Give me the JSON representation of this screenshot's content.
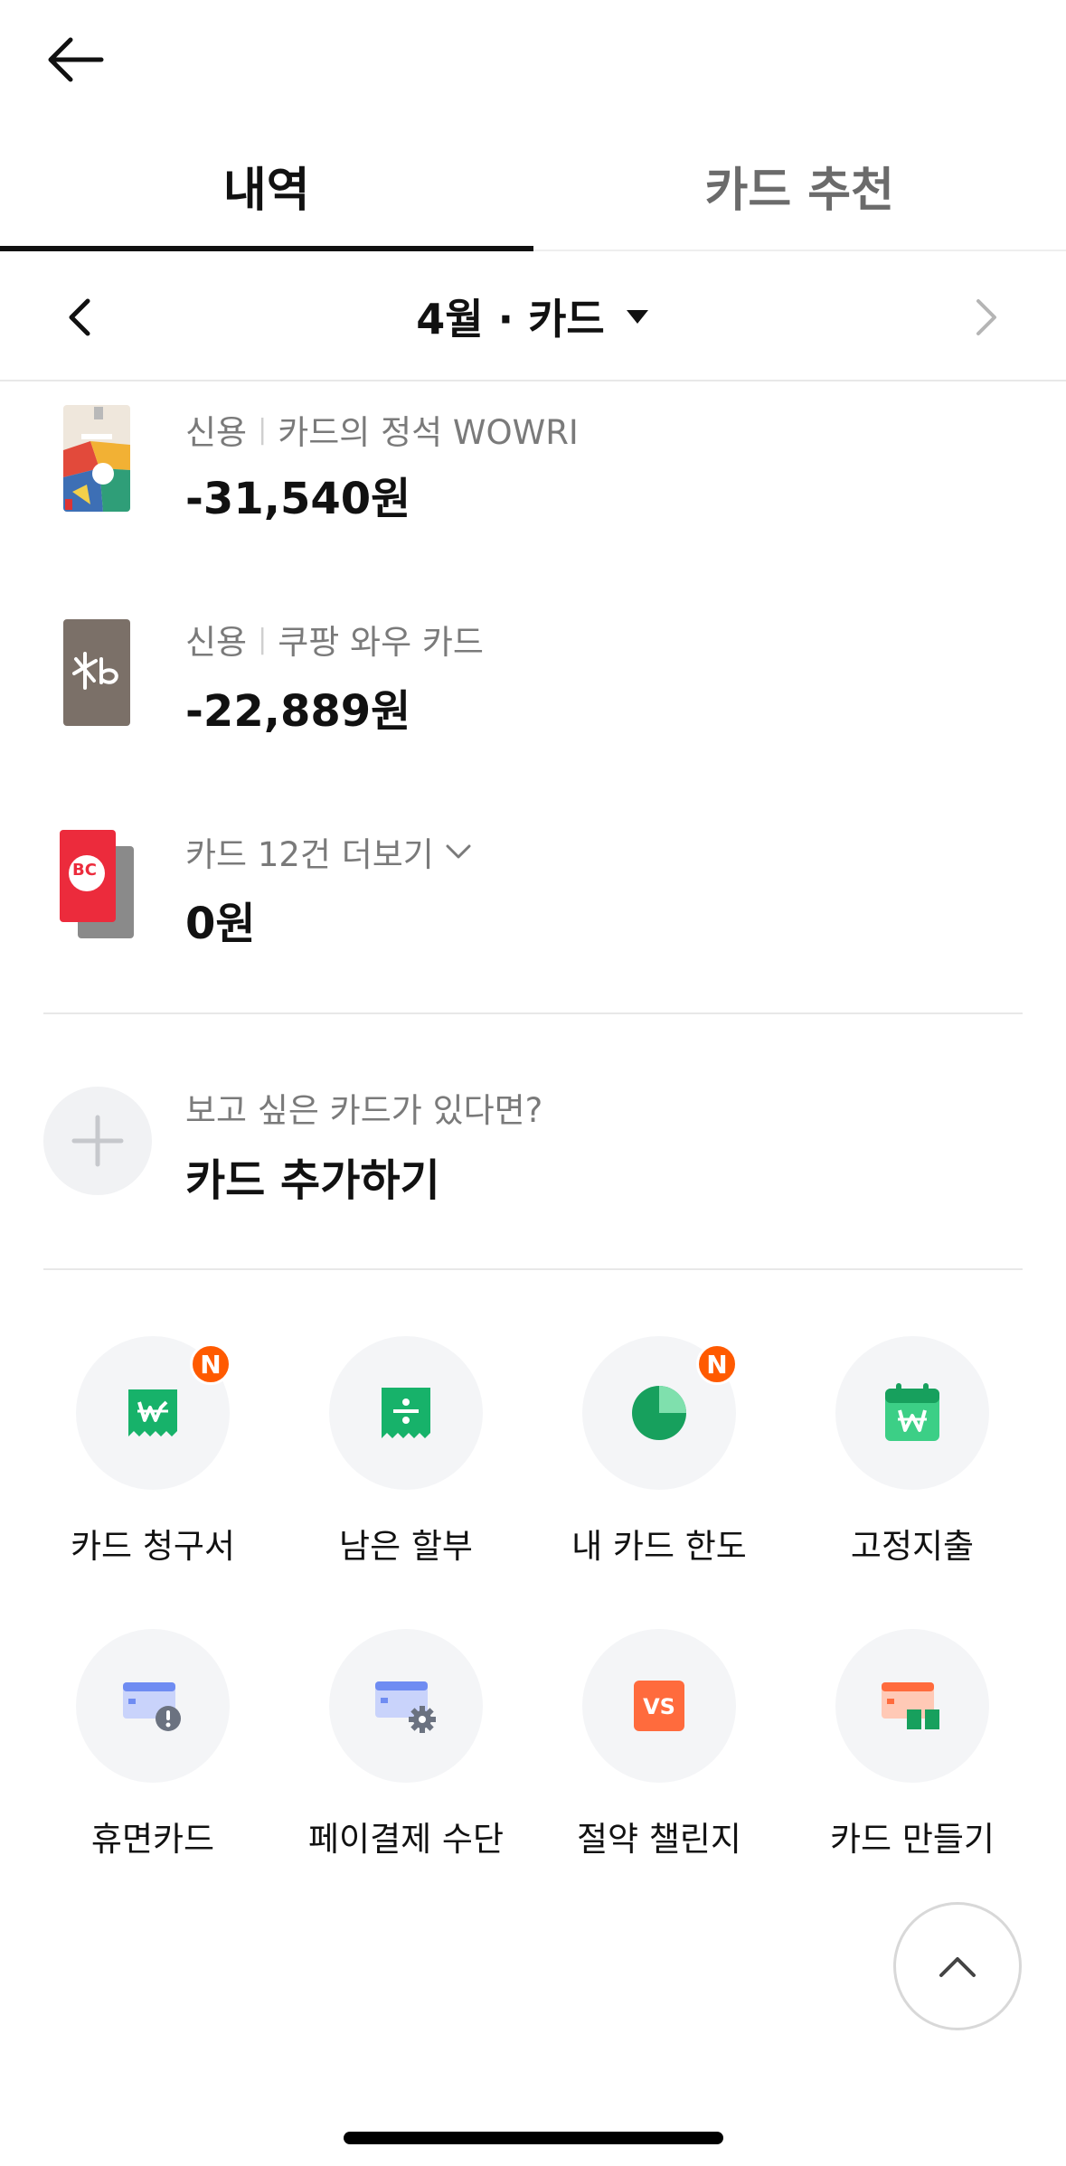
{
  "tabs": [
    {
      "label": "내역",
      "active": true
    },
    {
      "label": "카드 추천",
      "active": false
    }
  ],
  "month_selector": {
    "title": "4월 · 카드"
  },
  "cards": [
    {
      "type": "신용",
      "name": "카드의 정석 WOWRI",
      "amount": "-31,540원"
    },
    {
      "type": "신용",
      "name": "쿠팡 와우 카드",
      "amount": "-22,889원"
    },
    {
      "more_label": "카드 12건 더보기",
      "amount": "0원"
    }
  ],
  "add_card": {
    "subtitle": "보고 싶은 카드가 있다면?",
    "title": "카드 추가하기"
  },
  "menu": [
    {
      "label": "카드 청구서",
      "icon": "card-bill-icon",
      "badge": "N"
    },
    {
      "label": "남은 할부",
      "icon": "installment-icon",
      "badge": ""
    },
    {
      "label": "내 카드 한도",
      "icon": "pie-chart-icon",
      "badge": "N"
    },
    {
      "label": "고정지출",
      "icon": "calendar-won-icon",
      "badge": ""
    },
    {
      "label": "휴면카드",
      "icon": "dormant-card-icon",
      "badge": ""
    },
    {
      "label": "페이결제 수단",
      "icon": "card-settings-icon",
      "badge": ""
    },
    {
      "label": "절약 챌린지",
      "icon": "vs-icon",
      "badge": ""
    },
    {
      "label": "카드 만들기",
      "icon": "card-create-icon",
      "badge": ""
    }
  ],
  "colors": {
    "accent_green": "#1db86b",
    "badge_orange": "#ff5a00",
    "card_blue": "#6f8cf2",
    "vs_orange": "#ff6b3d"
  }
}
